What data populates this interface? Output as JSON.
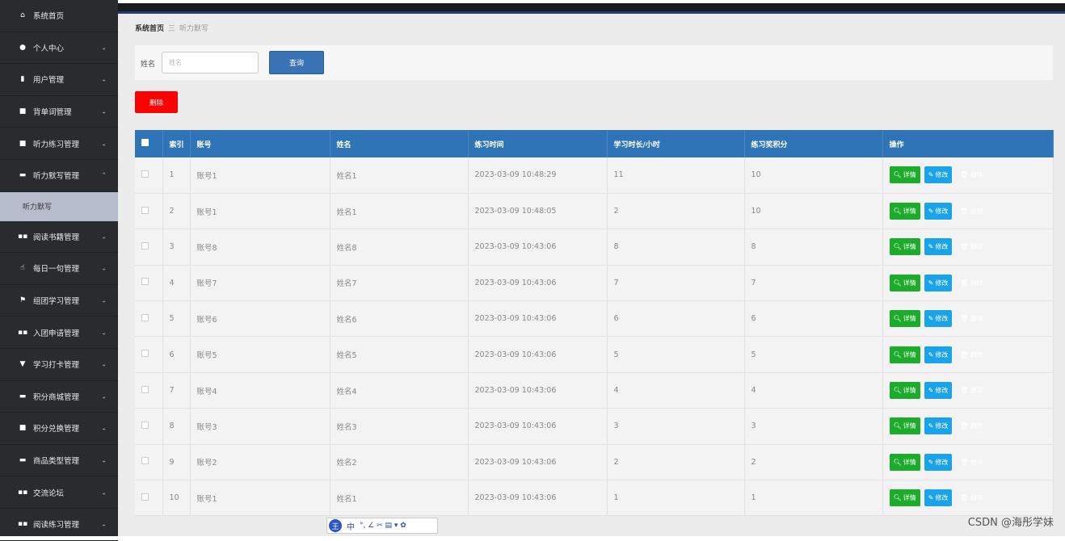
{
  "sidebar": {
    "items": [
      {
        "icon": "⌂",
        "label": "系统首页",
        "chev": ""
      },
      {
        "icon": "●",
        "label": "个人中心",
        "chev": "⌄"
      },
      {
        "icon": "▮",
        "label": "用户管理",
        "chev": "⌄"
      },
      {
        "icon": "■",
        "label": "背单词管理",
        "chev": "⌄"
      },
      {
        "icon": "■",
        "label": "听力练习管理",
        "chev": "⌄"
      },
      {
        "icon": "▬",
        "label": "听力默写管理",
        "chev": "⌃"
      },
      {
        "icon": "",
        "label": "听力默写",
        "chev": "",
        "sub": true
      },
      {
        "icon": "▪▪",
        "label": "阅读书籍管理",
        "chev": "⌄"
      },
      {
        "icon": "☝",
        "label": "每日一句管理",
        "chev": "⌄"
      },
      {
        "icon": "⚑",
        "label": "组团学习管理",
        "chev": "⌄"
      },
      {
        "icon": "▪▪",
        "label": "入团申请管理",
        "chev": "⌄"
      },
      {
        "icon": "▼",
        "label": "学习打卡管理",
        "chev": "⌄"
      },
      {
        "icon": "▬",
        "label": "积分商城管理",
        "chev": "⌄"
      },
      {
        "icon": "■",
        "label": "积分兑换管理",
        "chev": "⌄"
      },
      {
        "icon": "▬",
        "label": "商品类型管理",
        "chev": "⌄"
      },
      {
        "icon": "▪▪",
        "label": "交流论坛",
        "chev": "⌄"
      },
      {
        "icon": "▪▪",
        "label": "阅读练习管理",
        "chev": "⌄"
      }
    ]
  },
  "breadcrumb": {
    "home": "系统首页",
    "sep": "三",
    "current": "听力默写"
  },
  "search": {
    "label": "姓名",
    "placeholder": "姓名",
    "button": "查询"
  },
  "delete_button": "删除",
  "table": {
    "headers": [
      "",
      "索引",
      "账号",
      "姓名",
      "练习时间",
      "学习时长/小时",
      "练习奖积分",
      "操作"
    ],
    "rows": [
      [
        "1",
        "账号1",
        "姓名1",
        "2023-03-09 10:48:29",
        "11",
        "10"
      ],
      [
        "2",
        "账号1",
        "姓名1",
        "2023-03-09 10:48:05",
        "2",
        "10"
      ],
      [
        "3",
        "账号8",
        "姓名8",
        "2023-03-09 10:43:06",
        "8",
        "8"
      ],
      [
        "4",
        "账号7",
        "姓名7",
        "2023-03-09 10:43:06",
        "7",
        "7"
      ],
      [
        "5",
        "账号6",
        "姓名6",
        "2023-03-09 10:43:06",
        "6",
        "6"
      ],
      [
        "6",
        "账号5",
        "姓名5",
        "2023-03-09 10:43:06",
        "5",
        "5"
      ],
      [
        "7",
        "账号4",
        "姓名4",
        "2023-03-09 10:43:06",
        "4",
        "4"
      ],
      [
        "8",
        "账号3",
        "姓名3",
        "2023-03-09 10:43:06",
        "3",
        "3"
      ],
      [
        "9",
        "账号2",
        "姓名2",
        "2023-03-09 10:43:06",
        "2",
        "2"
      ],
      [
        "10",
        "账号1",
        "姓名1",
        "2023-03-09 10:43:06",
        "1",
        "1"
      ]
    ],
    "actions": {
      "detail": "详情",
      "edit": "修改",
      "delete": "删除"
    }
  },
  "ime_toolbar": {
    "logo": "王",
    "mode": "中",
    "glyphs": "°, ∠ ✂ ▤ ▾ ✿"
  },
  "watermark": "CSDN @海彤学妹",
  "colors": {
    "sidebar_bg": "#2a2b2e",
    "header_blue": "#2f74b6",
    "delete_red": "#ff0000",
    "detail_green": "#1dab2b",
    "edit_blue": "#1aa3e8",
    "row_delete_red": "#d84a4a"
  }
}
